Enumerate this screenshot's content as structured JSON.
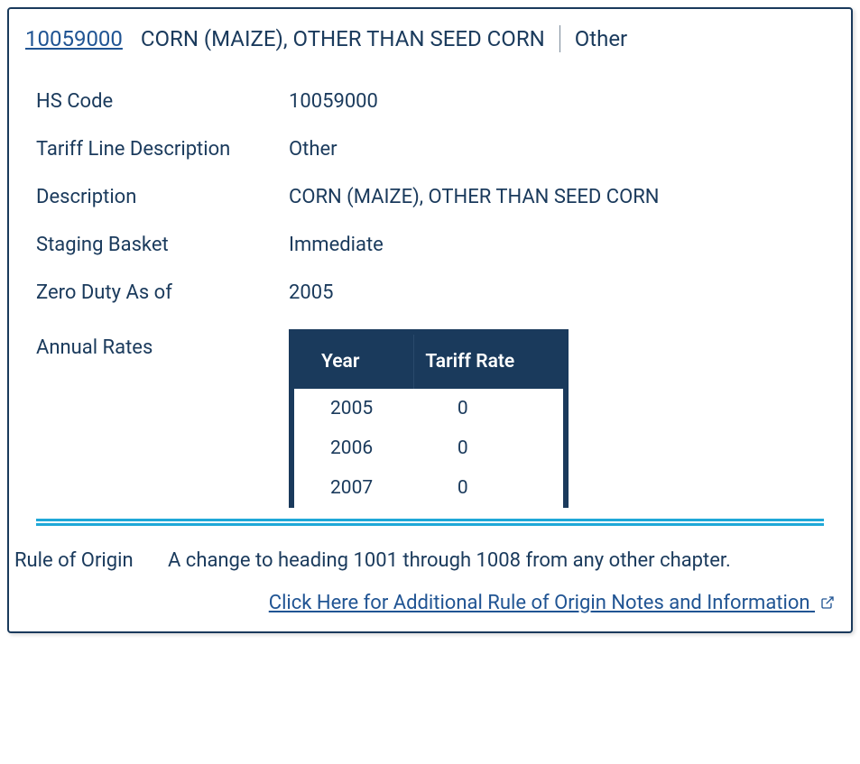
{
  "header": {
    "hs_link": "10059000",
    "description": "CORN (MAIZE), OTHER THAN SEED CORN",
    "other": "Other"
  },
  "details": {
    "hs_code": {
      "label": "HS Code",
      "value": "10059000"
    },
    "tariff_line": {
      "label": "Tariff Line Description",
      "value": "Other"
    },
    "description": {
      "label": "Description",
      "value": "CORN (MAIZE), OTHER THAN SEED CORN"
    },
    "staging": {
      "label": "Staging Basket",
      "value": "Immediate"
    },
    "zero_duty": {
      "label": "Zero Duty As of",
      "value": "2005"
    },
    "annual_rates_label": "Annual Rates"
  },
  "rates_table": {
    "headers": {
      "year": "Year",
      "rate": "Tariff Rate"
    },
    "rows": [
      {
        "year": "2005",
        "rate": "0"
      },
      {
        "year": "2006",
        "rate": "0"
      },
      {
        "year": "2007",
        "rate": "0"
      }
    ]
  },
  "origin": {
    "label": "Rule of Origin",
    "text": "A change to heading 1001 through 1008 from any other chapter."
  },
  "bottom_link": "Click Here for Additional Rule of Origin Notes and Information"
}
